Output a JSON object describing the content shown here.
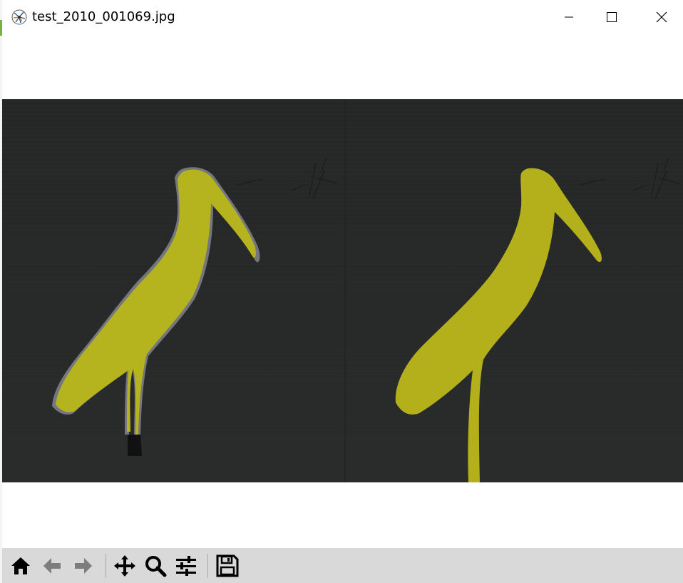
{
  "window": {
    "title": "test_2010_001069.jpg",
    "controls": {
      "minimize_icon": "minimize-icon",
      "maximize_icon": "maximize-icon",
      "close_icon": "close-icon"
    }
  },
  "figure": {
    "panels": [
      {
        "name": "left-panel",
        "subject": "stork silhouette mask",
        "mask_color": "#b5b31e"
      },
      {
        "name": "right-panel",
        "subject": "stork silhouette mask",
        "mask_color": "#b3b01b"
      }
    ],
    "background_color": "#262828"
  },
  "toolbar": {
    "tools": [
      {
        "name": "home-button",
        "icon": "home-icon"
      },
      {
        "name": "back-button",
        "icon": "arrow-left-icon"
      },
      {
        "name": "forward-button",
        "icon": "arrow-right-icon"
      },
      {
        "name": "pan-button",
        "icon": "move-icon"
      },
      {
        "name": "zoom-button",
        "icon": "zoom-icon"
      },
      {
        "name": "configure-subplots-button",
        "icon": "sliders-icon"
      },
      {
        "name": "save-button",
        "icon": "floppy-disk-icon"
      }
    ]
  },
  "colors": {
    "toolbar_bg": "#d9d9d9",
    "image_bg": "#262828",
    "mask_yellow": "#b5b31e"
  }
}
